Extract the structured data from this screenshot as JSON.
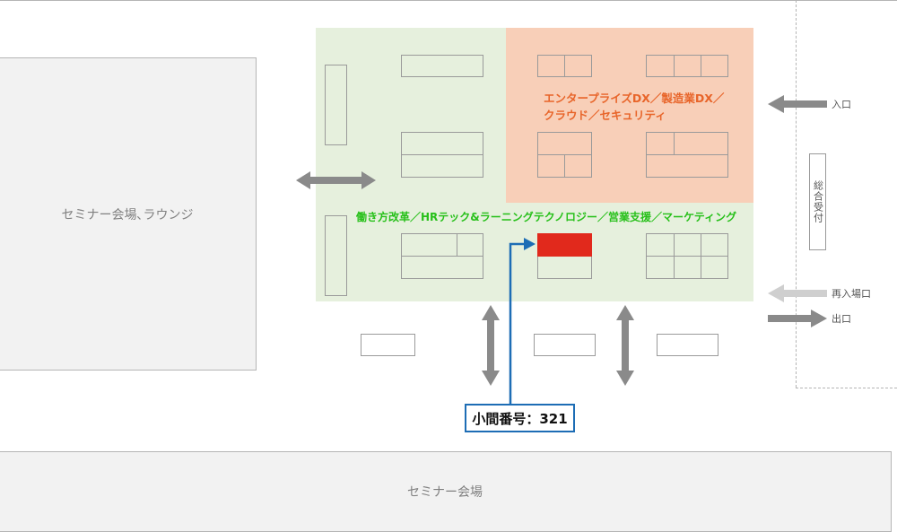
{
  "areas": {
    "seminar_lounge": "セミナー会場､ラウンジ",
    "seminar_hall": "セミナー会場"
  },
  "zones": {
    "orange_lines": [
      "エンタープライズDX／製造業DX／",
      "クラウド／セキュリティ"
    ],
    "green_label": "働き方改革／HRテック&ラーニングテクノロジー／営業支援／マーケティング"
  },
  "signs": {
    "entrance": "入口",
    "reentry": "再入場口",
    "exit": "出口",
    "reception": "総合受付"
  },
  "callout": {
    "booth_number": "小間番号：321"
  },
  "colors": {
    "green_zone": "#e6f0dd",
    "orange_zone": "#f8cfb8",
    "orange_text": "#e8652a",
    "green_text": "#27c01a",
    "highlight_booth": "#e1291c",
    "callout_blue": "#1d6db5",
    "arrow_gray": "#8a8a8a",
    "arrow_light": "#cfcfcf"
  }
}
